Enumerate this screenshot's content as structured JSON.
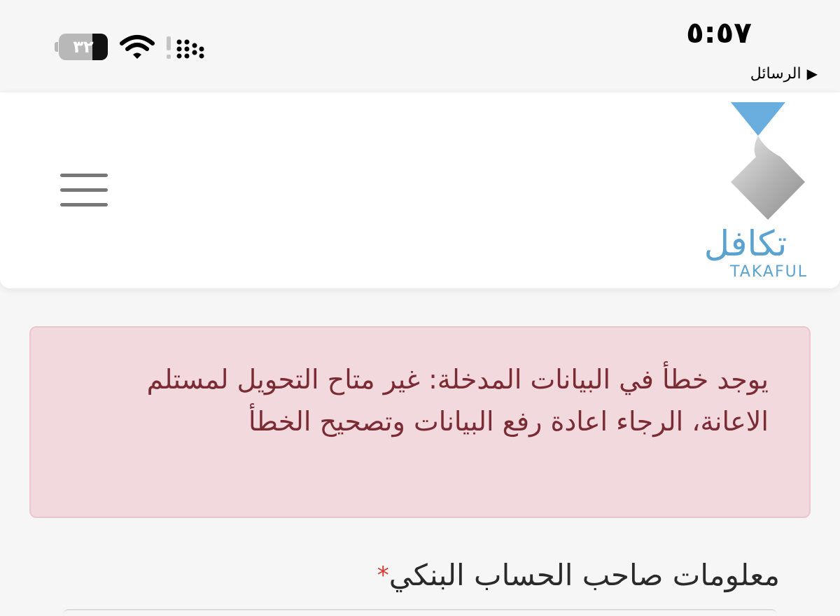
{
  "status_bar": {
    "time": "٥:٥٧",
    "back_label": "الرسائل",
    "battery_level": "٣٢",
    "battery_fraction": 0.32
  },
  "header": {
    "logo_arabic": "تكافل",
    "logo_latin": "TAKAFUL",
    "logo_colors": {
      "blue": "#5aa3d0",
      "silver": "#b0b0b0"
    }
  },
  "alert": {
    "message": "يوجد خطأ في البيانات المدخلة: غير متاح التحويل لمستلم الاعانة، الرجاء اعادة رفع البيانات وتصحيح الخطأ"
  },
  "form": {
    "section_title": "معلومات صاحب الحساب البنكي",
    "required_marker": "*"
  },
  "icons": {
    "menu": "hamburger-menu-icon",
    "wifi": "wifi-icon",
    "signal": "cellular-signal-icon",
    "battery": "battery-icon",
    "back": "back-arrow-icon"
  }
}
